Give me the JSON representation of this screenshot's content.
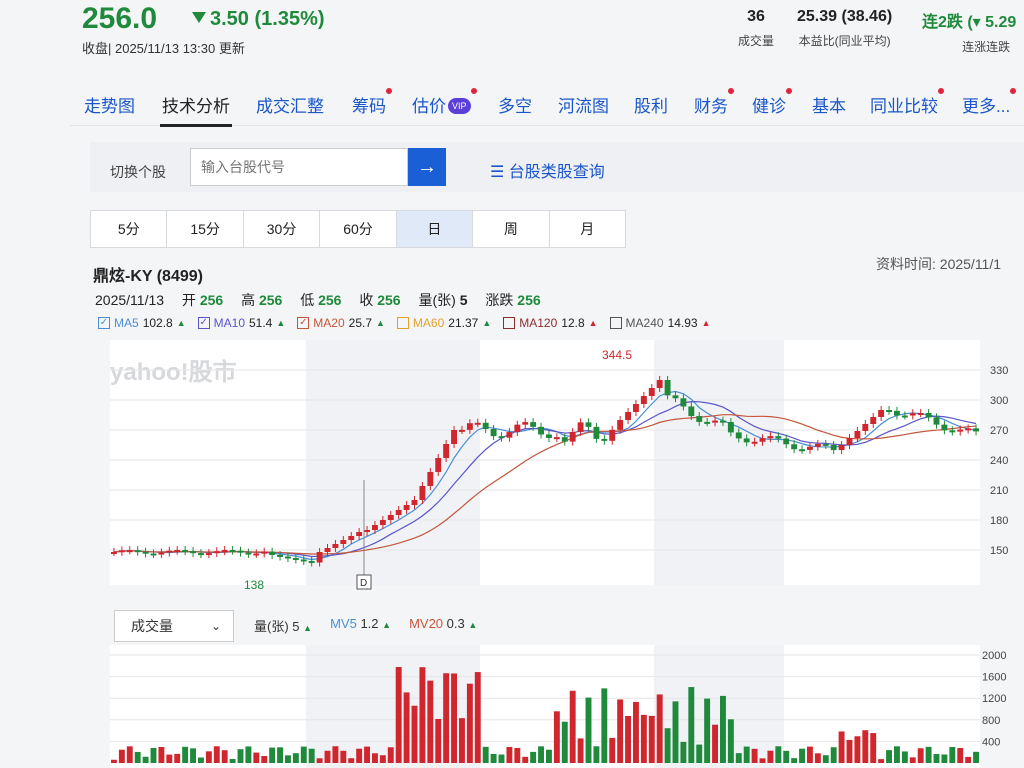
{
  "header": {
    "price": "256.0",
    "change": "3.50 (1.35%)",
    "status": "收盘| 2025/11/13 13:30 更新",
    "stats": [
      {
        "value": "36",
        "label": "成交量"
      },
      {
        "value": "25.39 (38.46)",
        "label": "本益比(同业平均)"
      },
      {
        "value": "连2跌 (▾ 5.29",
        "label": "连涨连跌"
      }
    ]
  },
  "tabs": [
    {
      "label": "走势图",
      "dot": false
    },
    {
      "label": "技术分析",
      "dot": false
    },
    {
      "label": "成交汇整",
      "dot": false
    },
    {
      "label": "筹码",
      "dot": true
    },
    {
      "label": "估价",
      "dot": true,
      "badge": "VIP"
    },
    {
      "label": "多空",
      "dot": false
    },
    {
      "label": "河流图",
      "dot": false
    },
    {
      "label": "股利",
      "dot": false
    },
    {
      "label": "财务",
      "dot": true
    },
    {
      "label": "健诊",
      "dot": true
    },
    {
      "label": "基本",
      "dot": false
    },
    {
      "label": "同业比较",
      "dot": true
    },
    {
      "label": "更多...",
      "dot": true
    }
  ],
  "search": {
    "label": "切换个股",
    "placeholder": "输入台股代号",
    "button": "→",
    "lookup": "台股类股查询"
  },
  "periods": [
    "5分",
    "15分",
    "30分",
    "60分",
    "日",
    "周",
    "月"
  ],
  "stock": {
    "name": "鼎炫-KY (8499)",
    "data_time": "资料时间: 2025/11/1",
    "date": "2025/11/13",
    "open_label": "开",
    "open": "256",
    "high_label": "高",
    "high": "256",
    "low_label": "低",
    "low": "256",
    "close_label": "收",
    "close": "256",
    "vol_label": "量(张)",
    "vol": "5",
    "chg_label": "涨跌",
    "chg": "256"
  },
  "ma": [
    {
      "name": "MA5",
      "value": "102.8",
      "color": "#4a8fd4",
      "dir": "up-green"
    },
    {
      "name": "MA10",
      "value": "51.4",
      "color": "#5a55c8",
      "dir": "up-green"
    },
    {
      "name": "MA20",
      "value": "25.7",
      "color": "#c4573b",
      "dir": "up-green"
    },
    {
      "name": "MA60",
      "value": "21.37",
      "color": "#e0a12c",
      "dir": "up-green"
    },
    {
      "name": "MA120",
      "value": "12.8",
      "color": "#8b2e2e",
      "dir": "up-red"
    },
    {
      "name": "MA240",
      "value": "14.93",
      "color": "#555555",
      "dir": "up-red"
    }
  ],
  "watermark": "yahoo!股市",
  "price_chart": {
    "y_ticks": [
      330,
      300,
      270,
      240,
      210,
      180,
      150
    ],
    "high_label": "344.5",
    "low_label": "138",
    "marker": "D"
  },
  "volume": {
    "select_label": "成交量",
    "legend": [
      {
        "label": "量(张)",
        "value": "5",
        "color": "#333333"
      },
      {
        "label": "MV5",
        "value": "1.2",
        "color": "#4a8fd4"
      },
      {
        "label": "MV20",
        "value": "0.3",
        "color": "#c4573b"
      }
    ],
    "y_ticks": [
      2000,
      1600,
      1200,
      800,
      400
    ]
  },
  "colors": {
    "up": "#d0262d",
    "down": "#1f8a3b",
    "link": "#1a56c9"
  }
}
